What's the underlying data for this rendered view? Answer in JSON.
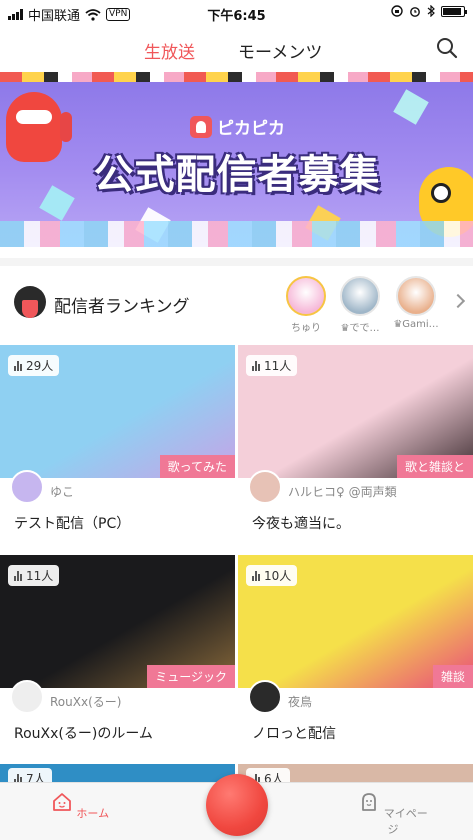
{
  "status_bar": {
    "carrier": "中国联通",
    "vpn": "VPN",
    "time": "下午6:45"
  },
  "top_nav": {
    "tabs": [
      {
        "label": "生放送",
        "active": true
      },
      {
        "label": "モーメンツ",
        "active": false
      }
    ],
    "search_icon": "search-icon"
  },
  "banner": {
    "brand": "ピカピカ",
    "title": "公式配信者募集"
  },
  "ranking": {
    "title": "配信者ランキング",
    "users": [
      {
        "name": "ちゅり",
        "color": "#f6b8d8"
      },
      {
        "name": "♛でで…",
        "color": "#9fb6c8"
      },
      {
        "name": "♛Gami…",
        "color": "#e9b08c"
      }
    ]
  },
  "streams": [
    {
      "viewers": "29人",
      "genre": "歌ってみた",
      "owner": "ゆこ",
      "title": "テスト配信（PC）",
      "bg": "#8fd0f2",
      "accent": "#c7a2e6",
      "avatar": "#c6b6ef"
    },
    {
      "viewers": "11人",
      "genre": "歌と雑談と",
      "owner": "ハルヒコ♀ @両声類",
      "title": "今夜も適当に。",
      "bg": "#f4cfd9",
      "accent": "#3a2a2e",
      "avatar": "#e7c2b6"
    },
    {
      "viewers": "11人",
      "genre": "ミュージック",
      "owner": "RouXx(るー)",
      "title": "RouXx(るー)のルーム",
      "bg": "#1a1a1c",
      "accent": "#8a6a3b",
      "avatar": "#eeeeee"
    },
    {
      "viewers": "10人",
      "genre": "雑談",
      "owner": "夜鳥",
      "title": "ノロっと配信",
      "bg": "#f5e04a",
      "accent": "#e94a7b",
      "avatar": "#2a2a2a"
    },
    {
      "viewers": "7人",
      "bg": "#2f8ec5"
    },
    {
      "viewers": "6人",
      "bg": "#d9b8a6"
    }
  ],
  "tab_bar": {
    "home": "ホーム",
    "mypage": "マイページ"
  },
  "colors": {
    "accent": "#f0575a",
    "genre_tag": "#f07896"
  }
}
